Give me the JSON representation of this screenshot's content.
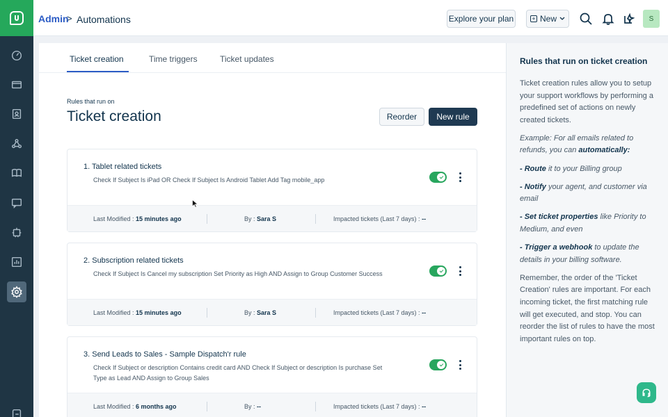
{
  "breadcrumb": {
    "root": "Admin",
    "separator": ">",
    "current": "Automations"
  },
  "topbar": {
    "explore_label": "Explore your plan",
    "new_label": "New",
    "avatar_initial": "S",
    "icons": [
      "search-icon",
      "bell-icon",
      "sparkle-icon"
    ]
  },
  "sidebar": {
    "icons": [
      "dashboard-icon",
      "tickets-icon",
      "contacts-icon",
      "groups-icon",
      "book-icon",
      "chat-icon",
      "bot-icon",
      "reports-icon",
      "settings-icon",
      "logout-icon"
    ],
    "active": "settings-icon"
  },
  "tabs": [
    {
      "label": "Ticket creation",
      "active": true
    },
    {
      "label": "Time triggers",
      "active": false
    },
    {
      "label": "Ticket updates",
      "active": false
    }
  ],
  "header": {
    "eyebrow": "Rules that run on",
    "title": "Ticket creation",
    "reorder_label": "Reorder",
    "new_rule_label": "New rule"
  },
  "rules": [
    {
      "title": "1.  Tablet related tickets",
      "description": "Check If Subject Is iPad OR Check If Subject Is Android Tablet Add Tag mobile_app",
      "enabled": true,
      "modified_label": "Last Modified :",
      "modified_value": "15 minutes ago",
      "by_label": "By :",
      "by_value": "Sara S",
      "impact_label": "Impacted tickets (Last 7 days) :",
      "impact_value": "--"
    },
    {
      "title": "2.  Subscription related tickets",
      "description": "Check If Subject Is Cancel my subscription Set Priority as High AND Assign to Group Customer Success",
      "enabled": true,
      "modified_label": "Last Modified :",
      "modified_value": "15 minutes ago",
      "by_label": "By :",
      "by_value": "Sara S",
      "impact_label": "Impacted tickets (Last 7 days) :",
      "impact_value": "--"
    },
    {
      "title": "3.  Send Leads to Sales - Sample Dispatch'r rule",
      "description": "Check If Subject or description Contains credit card AND Check If Subject or description Is purchase Set Type as Lead AND Assign to Group Sales",
      "enabled": true,
      "modified_label": "Last Modified :",
      "modified_value": "6 months ago",
      "by_label": "By :",
      "by_value": "--",
      "impact_label": "Impacted tickets (Last 7 days) :",
      "impact_value": "--"
    }
  ],
  "help": {
    "title": "Rules that run on ticket creation",
    "intro": "Ticket creation rules allow you to setup your support workflows by performing a predefined set of actions on newly created tickets.",
    "example_prefix": "Example: For all emails related to refunds, you can ",
    "example_bold": "automatically:",
    "bullets": [
      {
        "bold": "- Route",
        "rest": " it to your Billing group"
      },
      {
        "bold": "- Notify",
        "rest": " your agent, and customer via email"
      },
      {
        "bold": "- Set ticket properties",
        "rest": " like Priority to Medium, and even"
      },
      {
        "bold": "- Trigger a webhook",
        "rest": " to update the details in your billing software."
      }
    ],
    "closing": "Remember, the order of the 'Ticket Creation' rules are important. For each incoming ticket, the first matching rule will get executed, and stop. You can reorder the list of rules to have the most important rules on top."
  },
  "colors": {
    "accent": "#2c5cc5",
    "brand": "#25a85b",
    "toggle_on": "#28a65e",
    "primary_button": "#1f3a52",
    "rail": "#1f3544"
  }
}
